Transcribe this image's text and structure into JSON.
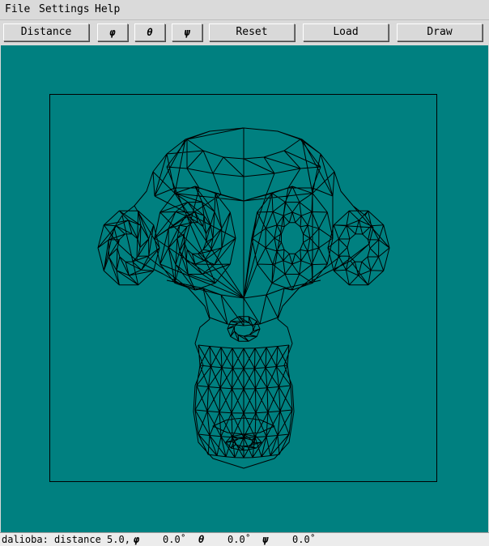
{
  "menubar": {
    "items": [
      "File",
      "Settings",
      "Help"
    ]
  },
  "toolbar": {
    "distance_label": "Distance",
    "phi_label": "φ",
    "theta_label": "θ",
    "psi_label": "ψ",
    "reset_label": "Reset",
    "load_label": "Load",
    "draw_label": "Draw"
  },
  "canvas": {
    "background": "#008080",
    "line_color": "#000000",
    "model": "wireframe monkey head"
  },
  "status": {
    "prefix": "dalioba: distance 5.0,",
    "phi_symbol": "φ",
    "phi_value": "0.0˚",
    "theta_symbol": "θ",
    "theta_value": "0.0˚",
    "psi_symbol": "ψ",
    "psi_value": "0.0˚"
  }
}
